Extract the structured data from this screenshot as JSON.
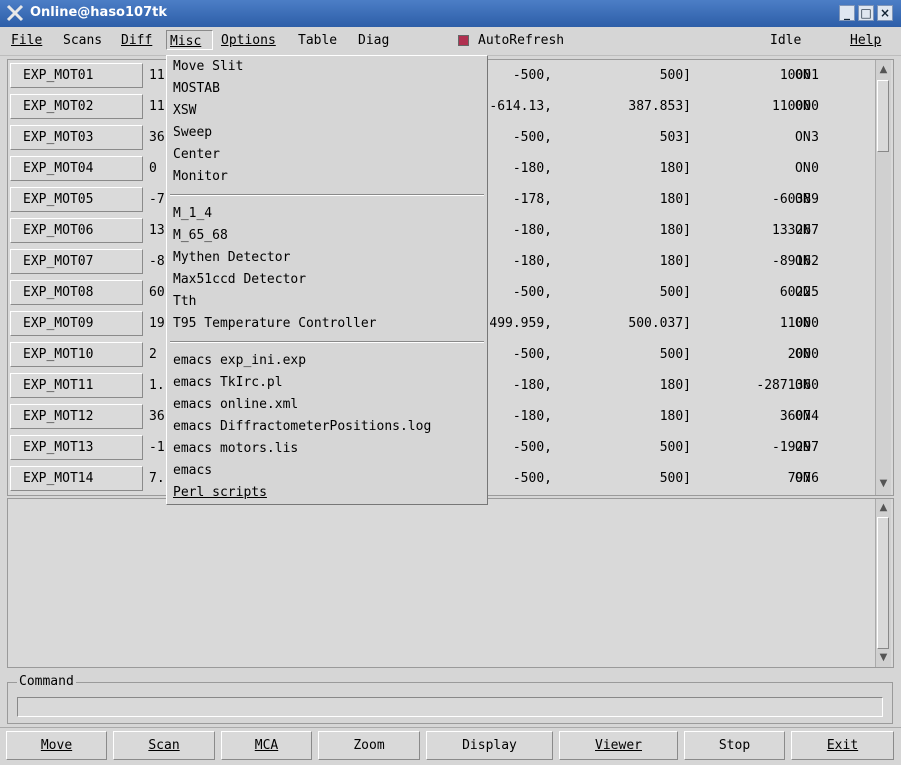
{
  "window": {
    "title": "Online@haso107tk"
  },
  "menubar": {
    "items": [
      "File",
      "Scans",
      "Diff",
      "Misc",
      "Options",
      "Table",
      "Diag"
    ],
    "autorefresh_label": "AutoRefresh",
    "status": "Idle",
    "help": "Help"
  },
  "motors": [
    {
      "name": "EXP_MOT01",
      "value": "11",
      "low": "-500,",
      "high": "500]",
      "steps": "10001",
      "state": "ON"
    },
    {
      "name": "EXP_MOT02",
      "value": "11",
      "low": "-614.13,",
      "high": "387.853]",
      "steps": "110000",
      "state": "ON"
    },
    {
      "name": "EXP_MOT03",
      "value": "36",
      "low": "-500,",
      "high": "503]",
      "steps": "3",
      "state": "ON"
    },
    {
      "name": "EXP_MOT04",
      "value": "0",
      "low": "-180,",
      "high": "180]",
      "steps": "0",
      "state": "ON"
    },
    {
      "name": "EXP_MOT05",
      "value": "-7",
      "low": "-178,",
      "high": "180]",
      "steps": "-60389",
      "state": "ON"
    },
    {
      "name": "EXP_MOT06",
      "value": "13",
      "low": "-180,",
      "high": "180]",
      "steps": "133267",
      "state": "ON"
    },
    {
      "name": "EXP_MOT07",
      "value": "-8",
      "low": "-180,",
      "high": "180]",
      "steps": "-89162",
      "state": "ON"
    },
    {
      "name": "EXP_MOT08",
      "value": "60",
      "low": "-500,",
      "high": "500]",
      "steps": "60225",
      "state": "ON"
    },
    {
      "name": "EXP_MOT09",
      "value": "19",
      "low": "499.959,",
      "high": "500.037]",
      "steps": "11000",
      "state": "ON"
    },
    {
      "name": "EXP_MOT10",
      "value": "2",
      "low": "-500,",
      "high": "500]",
      "steps": "2000",
      "state": "ON"
    },
    {
      "name": "EXP_MOT11",
      "value": "1.",
      "low": "-180,",
      "high": "180]",
      "steps": "-2871360",
      "state": "ON"
    },
    {
      "name": "EXP_MOT12",
      "value": "36",
      "low": "-180,",
      "high": "180]",
      "steps": "36074",
      "state": "ON"
    },
    {
      "name": "EXP_MOT13",
      "value": "-1",
      "low": "-500,",
      "high": "500]",
      "steps": "-19297",
      "state": "ON"
    },
    {
      "name": "EXP_MOT14",
      "value": "7.",
      "low": "-500,",
      "high": "500]",
      "steps": "7976",
      "state": "ON"
    }
  ],
  "misc_menu": {
    "group1": [
      "Move Slit",
      "MOSTAB",
      "XSW",
      "Sweep",
      "Center",
      "Monitor"
    ],
    "group2": [
      "M_1_4",
      "M_65_68",
      "Mythen Detector",
      "Max51ccd Detector",
      "Tth",
      "T95 Temperature Controller"
    ],
    "group3": [
      "emacs exp_ini.exp",
      "emacs TkIrc.pl",
      "emacs online.xml",
      "emacs DiffractometerPositions.log",
      "emacs motors.lis",
      "emacs",
      "Perl scripts"
    ]
  },
  "command": {
    "label": "Command",
    "value": ""
  },
  "bottom_buttons": [
    "Move",
    "Scan",
    "MCA",
    "Zoom",
    "Display",
    "Viewer",
    "Stop",
    "Exit"
  ],
  "colors": {
    "titlebar": "#2d5ea8",
    "autorefresh_checkbox": "#b03050",
    "background": "#d6d6d6"
  }
}
